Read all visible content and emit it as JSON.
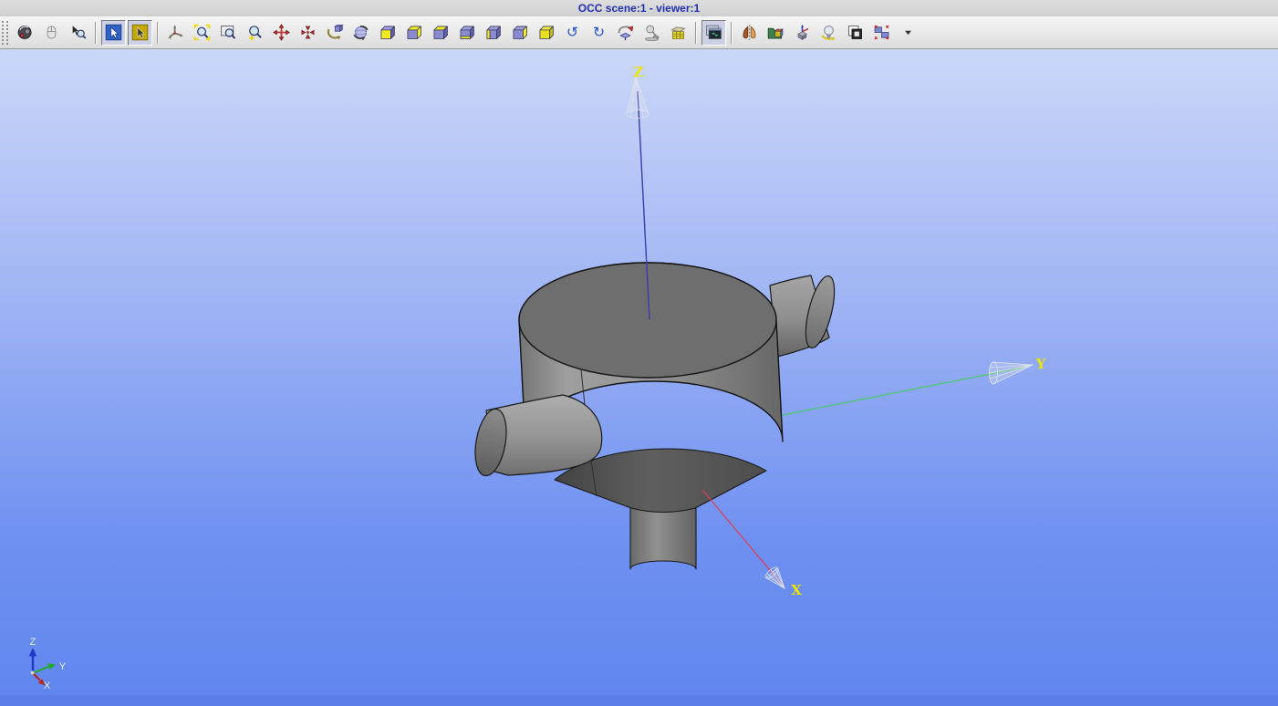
{
  "window": {
    "title": "OCC scene:1 - viewer:1"
  },
  "toolbar": {
    "buttons": [
      {
        "name": "scene-orbit-button",
        "icon": "scene_orbit",
        "pressed": false
      },
      {
        "name": "mouse-mode-button",
        "icon": "mouse",
        "pressed": false
      },
      {
        "name": "zoom-select-button",
        "icon": "zoom_select",
        "pressed": false
      },
      {
        "sep": true
      },
      {
        "name": "select-mode-button",
        "icon": "select_blue",
        "pressed": true
      },
      {
        "name": "highlight-mode-button",
        "icon": "select_yellow",
        "pressed": true
      },
      {
        "sep": true
      },
      {
        "name": "trihedron-toggle-button",
        "icon": "trihedron",
        "pressed": false
      },
      {
        "name": "fit-all-button",
        "icon": "fit_all",
        "pressed": false
      },
      {
        "name": "fit-area-button",
        "icon": "fit_area",
        "pressed": false
      },
      {
        "name": "zoom-button",
        "icon": "zoom_plus",
        "pressed": false
      },
      {
        "name": "pan-button",
        "icon": "pan",
        "pressed": false
      },
      {
        "name": "global-pan-button",
        "icon": "global_pan",
        "pressed": false
      },
      {
        "name": "rotate-button",
        "icon": "rotate",
        "pressed": false
      },
      {
        "name": "rotation-sphere-button",
        "icon": "rotation_sphere",
        "pressed": false
      },
      {
        "name": "front-view-button",
        "icon": "view_front",
        "pressed": false
      },
      {
        "name": "back-view-button",
        "icon": "view_back",
        "pressed": false
      },
      {
        "name": "top-view-button",
        "icon": "view_top",
        "pressed": false
      },
      {
        "name": "bottom-view-button",
        "icon": "view_bottom",
        "pressed": false
      },
      {
        "name": "left-view-button",
        "icon": "view_left",
        "pressed": false
      },
      {
        "name": "right-view-button",
        "icon": "view_right",
        "pressed": false
      },
      {
        "name": "axo-view-button",
        "icon": "view_axo",
        "pressed": false
      },
      {
        "name": "undo-view-button",
        "icon": "undo",
        "pressed": false
      },
      {
        "name": "redo-view-button",
        "icon": "redo",
        "pressed": false
      },
      {
        "name": "reset-view-button",
        "icon": "reset_view",
        "pressed": false
      },
      {
        "name": "hidden-line-button",
        "icon": "lamp",
        "pressed": false
      },
      {
        "name": "shading-table-button",
        "icon": "grid_table",
        "pressed": false
      },
      {
        "sep": true
      },
      {
        "name": "console-window-button",
        "icon": "console_window",
        "pressed": true
      },
      {
        "sep": true
      },
      {
        "name": "mirror-button",
        "icon": "mirror",
        "pressed": false
      },
      {
        "name": "import-scene-button",
        "icon": "scene_folder",
        "pressed": false
      },
      {
        "name": "trihedron-cube-button",
        "icon": "axis_cube",
        "pressed": false
      },
      {
        "name": "lighting-button",
        "icon": "light_bulb",
        "pressed": false
      },
      {
        "name": "background-color-button",
        "icon": "bg_swap",
        "pressed": false
      },
      {
        "name": "tile-windows-button",
        "icon": "tile_windows",
        "pressed": false
      },
      {
        "name": "toolbar-overflow-button",
        "icon": "overflow_arrow",
        "pressed": false
      }
    ]
  },
  "viewport": {
    "axis_labels": {
      "x": "X",
      "y": "Y",
      "z": "Z"
    },
    "mini_axis_labels": {
      "x": "X",
      "y": "Y",
      "z": "Z"
    },
    "colors": {
      "background_top": "#cbd7f8",
      "background_bottom": "#6187ef",
      "bottom_strip": "#5b7ee9",
      "axis_x_line": "#d84058",
      "axis_y_line": "#4ec86e",
      "axis_z_line": "#3c3caa",
      "axis_label_yellow": "#ede400",
      "model_gray": "#8f8f8f"
    }
  }
}
